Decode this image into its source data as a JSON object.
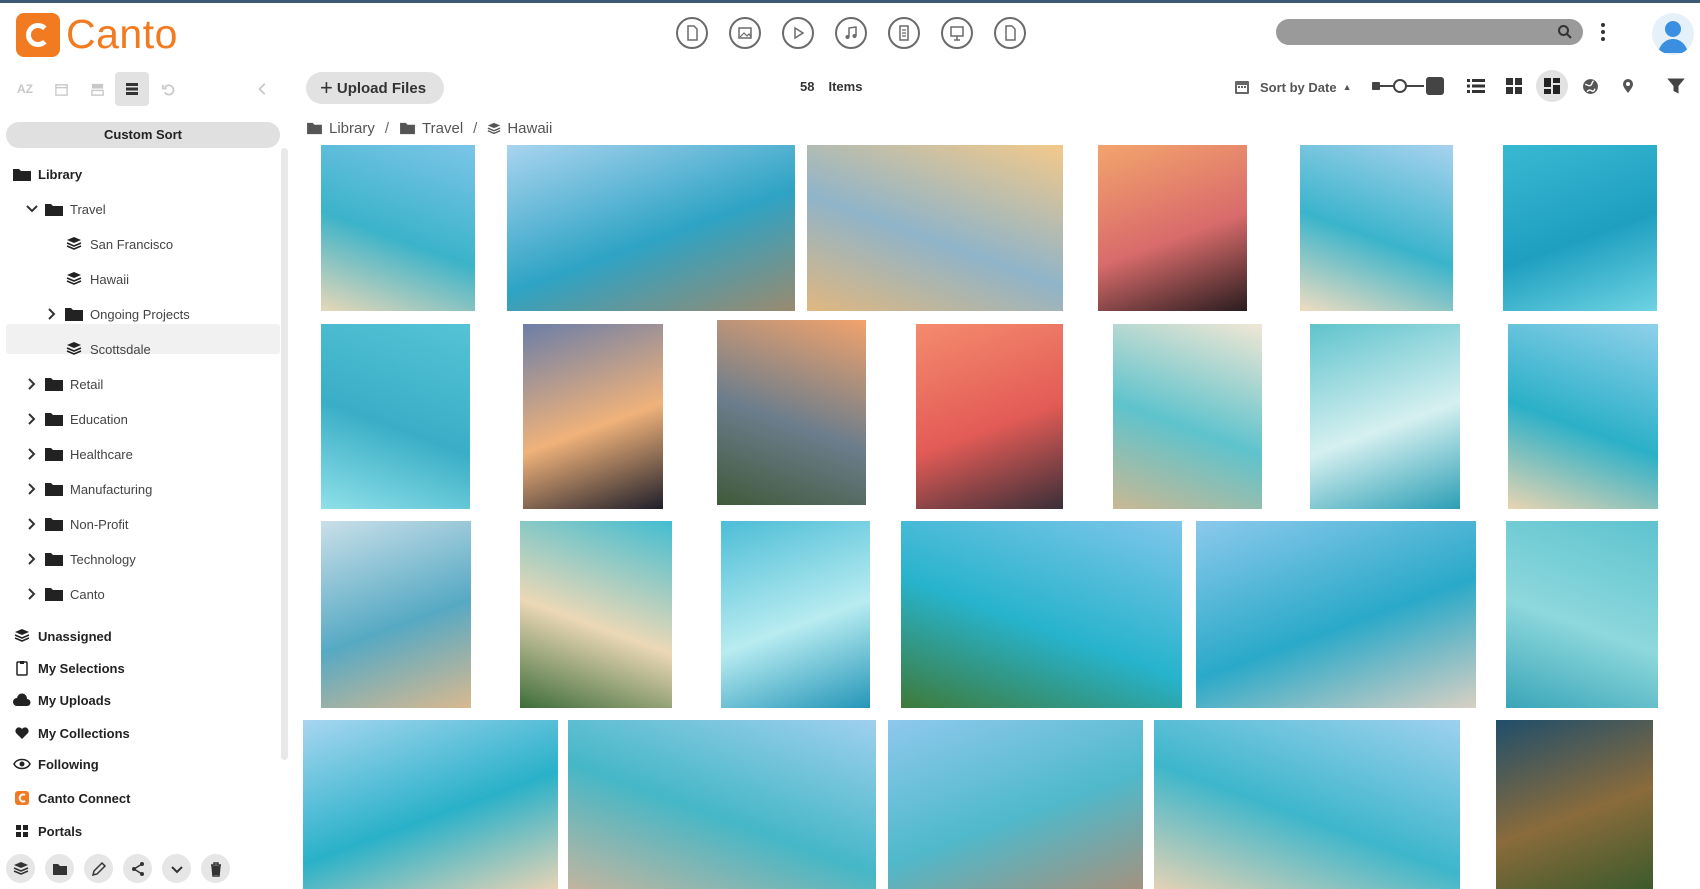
{
  "app": {
    "name": "Canto"
  },
  "header": {
    "type_filters": [
      "document-icon",
      "image-icon",
      "video-icon",
      "audio-icon",
      "text-icon",
      "presentation-icon",
      "other-icon"
    ],
    "search": {
      "placeholder": ""
    }
  },
  "sidebar": {
    "custom_sort": "Custom Sort",
    "library_label": "Library",
    "tree": [
      {
        "label": "Travel",
        "icon": "folder-icon"
      },
      {
        "label": "San Francisco",
        "icon": "album-icon"
      },
      {
        "label": "Hawaii",
        "icon": "album-icon"
      },
      {
        "label": "Ongoing Projects",
        "icon": "folder-icon"
      },
      {
        "label": "Scottsdale",
        "icon": "album-icon"
      },
      {
        "label": "Retail",
        "icon": "folder-icon"
      },
      {
        "label": "Education",
        "icon": "folder-icon"
      },
      {
        "label": "Healthcare",
        "icon": "folder-icon"
      },
      {
        "label": "Manufacturing",
        "icon": "folder-icon"
      },
      {
        "label": "Non-Profit",
        "icon": "folder-icon"
      },
      {
        "label": "Technology",
        "icon": "folder-icon"
      },
      {
        "label": "Canto",
        "icon": "folder-icon"
      }
    ],
    "sections": [
      {
        "label": "Unassigned",
        "icon": "stack-icon"
      },
      {
        "label": "My Selections",
        "icon": "clipboard-icon"
      },
      {
        "label": "My Uploads",
        "icon": "cloud-upload-icon"
      },
      {
        "label": "My Collections",
        "icon": "heart-icon"
      },
      {
        "label": "Following",
        "icon": "eye-icon"
      },
      {
        "label": "Canto Connect",
        "icon": "canto-connect-icon"
      },
      {
        "label": "Portals",
        "icon": "grid-icon"
      }
    ],
    "toolbar_az": "AZ"
  },
  "toolbar": {
    "upload_label": "Upload Files",
    "items_count": "58",
    "items_label": "Items",
    "sort_label": "Sort by Date",
    "sort_caret": "▲"
  },
  "breadcrumb": [
    "Library",
    "Travel",
    "Hawaii"
  ],
  "colors": {
    "brand": "#f27a21",
    "active_bg": "#e2e2e2"
  },
  "gallery": [
    {
      "row": 1,
      "scene": "beach-resort-aerial"
    },
    {
      "row": 1,
      "scene": "diamond-head-surfers"
    },
    {
      "row": 1,
      "scene": "sunset-beach"
    },
    {
      "row": 1,
      "scene": "tree-silhouette-sunset"
    },
    {
      "row": 1,
      "scene": "resort-beach"
    },
    {
      "row": 1,
      "scene": "ocean-swimmer"
    },
    {
      "row": 2,
      "scene": "paddleboarders-aerial"
    },
    {
      "row": 2,
      "scene": "palm-silhouette-dusk"
    },
    {
      "row": 2,
      "scene": "city-sunset-valley"
    },
    {
      "row": 2,
      "scene": "palm-sunset-red"
    },
    {
      "row": 2,
      "scene": "beach-crowd-aerial"
    },
    {
      "row": 2,
      "scene": "ocean-foam"
    },
    {
      "row": 2,
      "scene": "catamaran-beach"
    },
    {
      "row": 3,
      "scene": "city-shoreline"
    },
    {
      "row": 3,
      "scene": "palms-beach-aerial"
    },
    {
      "row": 3,
      "scene": "surfers-wave"
    },
    {
      "row": 3,
      "scene": "waikiki-hotels"
    },
    {
      "row": 3,
      "scene": "waikiki-diamond-head"
    },
    {
      "row": 3,
      "scene": "clear-water"
    },
    {
      "row": 4,
      "scene": "beach-palms-boat"
    },
    {
      "row": 4,
      "scene": "hotel-towers-beach"
    },
    {
      "row": 4,
      "scene": "towers-shore"
    },
    {
      "row": 4,
      "scene": "waikiki-view"
    },
    {
      "row": 4,
      "scene": "coastal-road-aerial"
    }
  ]
}
